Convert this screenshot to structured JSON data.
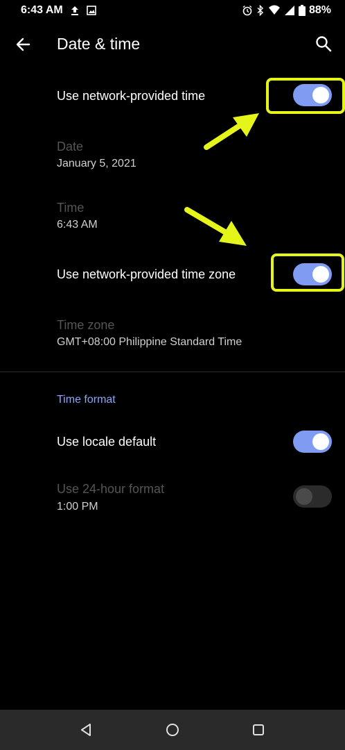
{
  "status_bar": {
    "time": "6:43 AM",
    "battery": "88%",
    "left_icons": [
      "upload-icon",
      "image-icon"
    ],
    "right_icons": [
      "alarm-icon",
      "bluetooth-icon",
      "wifi-icon",
      "signal-icon",
      "battery-icon"
    ]
  },
  "app_bar": {
    "title": "Date & time",
    "back_icon": "arrow-back-icon",
    "search_icon": "search-icon"
  },
  "settings": {
    "network_time": {
      "label": "Use network-provided time",
      "checked": true
    },
    "date": {
      "label": "Date",
      "value": "January 5, 2021",
      "enabled": false
    },
    "time": {
      "label": "Time",
      "value": "6:43 AM",
      "enabled": false
    },
    "network_zone": {
      "label": "Use network-provided time zone",
      "checked": true
    },
    "time_zone": {
      "label": "Time zone",
      "value": "GMT+08:00 Philippine Standard Time",
      "enabled": false
    }
  },
  "time_format": {
    "header": "Time format",
    "locale_default": {
      "label": "Use locale default",
      "checked": true
    },
    "hour24": {
      "label": "Use 24-hour format",
      "value": "1:00 PM",
      "enabled": false,
      "checked": false
    }
  },
  "annotations": {
    "highlight_color": "#e5f51a",
    "arrows": 2,
    "boxes": 2
  },
  "colors": {
    "accent": "#7f9cf2",
    "section_header": "#8fa6f5",
    "background": "#000000",
    "nav_bar": "#2a2a2a"
  },
  "nav_bar": {
    "buttons": [
      "back-triangle-icon",
      "home-circle-icon",
      "recents-square-icon"
    ]
  }
}
